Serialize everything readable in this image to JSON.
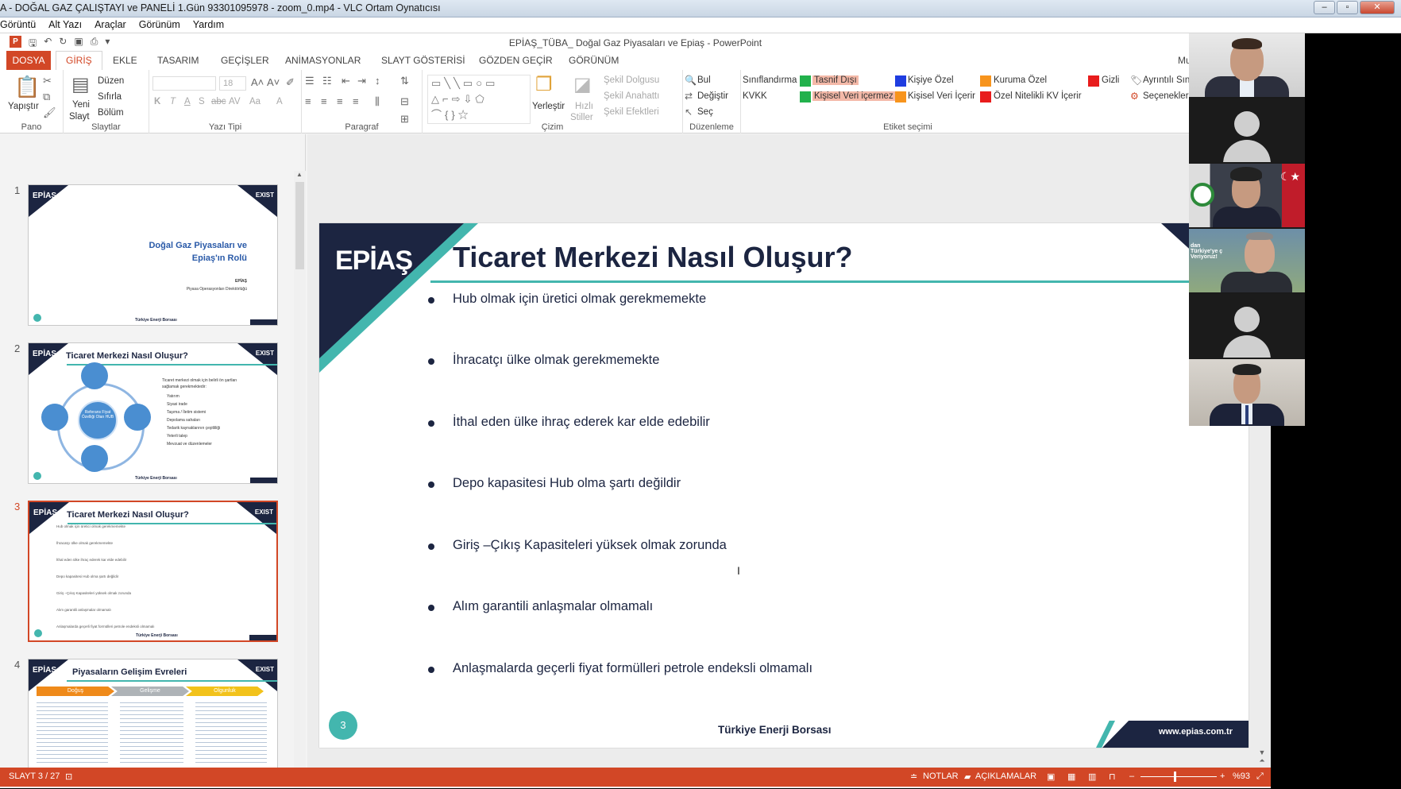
{
  "vlc": {
    "title": "A - DOĞAL GAZ ÇALIŞTAYI ve PANELİ 1.Gün 93301095978 - zoom_0.mp4 - VLC Ortam Oynatıcısı",
    "menu": [
      "Görüntü",
      "Alt Yazı",
      "Araçlar",
      "Görünüm",
      "Yardım"
    ],
    "win_buttons": [
      "–",
      "▫",
      "✕"
    ]
  },
  "ppt": {
    "title": "EPİAŞ_TÜBA_ Doğal Gaz Piyasaları ve Epiaş - PowerPoint",
    "tabs": [
      "DOSYA",
      "GİRİŞ",
      "EKLE",
      "TASARIM",
      "GEÇİŞLER",
      "ANİMASYONLAR",
      "SLAYT GÖSTERİSİ",
      "GÖZDEN GEÇİR",
      "GÖRÜNÜM"
    ],
    "tab_cut": "Mu"
  },
  "ribbon": {
    "pano": {
      "paste": "Yapıştır",
      "label": "Pano"
    },
    "slaytlar": {
      "new1": "Yeni",
      "new2": "Slayt",
      "duzen": "Düzen",
      "sifirla": "Sıfırla",
      "bolum": "Bölüm",
      "label": "Slaytlar"
    },
    "yazi": {
      "size": "18",
      "bold": "K",
      "italic": "T",
      "underline": "A",
      "shadow": "S",
      "strike": "abc",
      "spacing": "AV",
      "case": "Aa",
      "color": "A",
      "label": "Yazı Tipi"
    },
    "paragraf": {
      "label": "Paragraf"
    },
    "cizim": {
      "yerlestir": "Yerleştir",
      "hizli1": "Hızlı",
      "hizli2": "Stiller",
      "fill": "Şekil Dolgusu",
      "outline": "Şekil Anahattı",
      "effects": "Şekil Efektleri",
      "label": "Çizim"
    },
    "duzenleme": {
      "bul": "Bul",
      "degistir": "Değiştir",
      "sec": "Seç",
      "label": "Düzenleme"
    },
    "etiket": {
      "siniflandirma": "Sınıflandırma",
      "kvkk": "KVKK",
      "tags": [
        {
          "label": "Tasnif Dışı",
          "color": "#22b14c"
        },
        {
          "label": "Kişisel Veri içermez",
          "color": "#22b14c"
        },
        {
          "label": "Kişiye Özel",
          "color": "#1f3de0"
        },
        {
          "label": "Kişisel Veri İçerir",
          "color": "#f7941d"
        },
        {
          "label": "Kuruma Özel",
          "color": "#f7941d"
        },
        {
          "label": "Özel Nitelikli KV İçerir",
          "color": "#e81c1c"
        },
        {
          "label": "Gizli",
          "color": "#e81c1c"
        }
      ],
      "ayrintili": "Ayrıntılı Sın",
      "secenekler": "Seçenekler",
      "label": "Etiket seçimi"
    }
  },
  "thumbnails": [
    {
      "num": "1",
      "title": "Doğal Gaz Piyasaları ve Epiaş'ın Rolü",
      "line1": "Doğal Gaz Piyasaları ve",
      "line2": "Epiaş'ın Rolü",
      "sub1": "EPİAŞ",
      "sub2": "Piyasa Operasyonları Direktörlüğü",
      "footer": "Türkiye Enerji Borsası"
    },
    {
      "num": "2",
      "title": "Ticaret Merkezi Nasıl Oluşur?",
      "center": "Referans Fiyat Özelliği Olan HUB",
      "intro1": "Ticaret merkezi olmak için belirli ön şartları",
      "intro2": "sağlamak gerekmektedir:",
      "items": [
        "Yatırım",
        "Siyasi irade",
        "Taşıma / İletim sistemi",
        "Depolama sahaları",
        "Tedarik kaynaklarının çeşitliliği",
        "Yeterli talep",
        "Mevzuat ve düzenlemeler"
      ],
      "footer": "Türkiye Enerji Borsası"
    },
    {
      "num": "3",
      "title": "Ticaret Merkezi Nasıl Oluşur?",
      "footer": "Türkiye Enerji Borsası"
    },
    {
      "num": "4",
      "title": "Piyasaların Gelişim Evreleri",
      "phases": [
        "Doğuş",
        "Gelişme",
        "Olgunluk"
      ],
      "footer": "Türkiye Enerji Borsası"
    }
  ],
  "slide": {
    "logo": "EPİAŞ",
    "corner": "E",
    "title": "Ticaret Merkezi Nasıl Oluşur?",
    "bullets": [
      "Hub olmak için üretici olmak gerekmemekte",
      "İhracatçı ülke olmak gerekmemekte",
      "İthal eden ülke ihraç ederek kar elde edebilir",
      "Depo kapasitesi Hub olma şartı değildir",
      "Giriş –Çıkış Kapasiteleri yüksek olmak zorunda",
      "Alım garantili anlaşmalar olmamalı",
      "Anlaşmalarda geçerli fiyat formülleri petrole endeksli olmamalı"
    ],
    "number": "3",
    "footer": "Türkiye Enerji Borsası",
    "website": "www.epias.com.tr",
    "thumb_exist": "EXIST",
    "thumb_logo": "EPİAŞ"
  },
  "status": {
    "slide": "SLAYT 3 / 27",
    "notes": "NOTLAR",
    "comments": "AÇIKLAMALAR",
    "zoom": "%93",
    "zoom_level": 0.44
  },
  "zoom": {
    "participants": 6,
    "overlay": "dan Türkiye'ye ç Veriyoruz!"
  }
}
